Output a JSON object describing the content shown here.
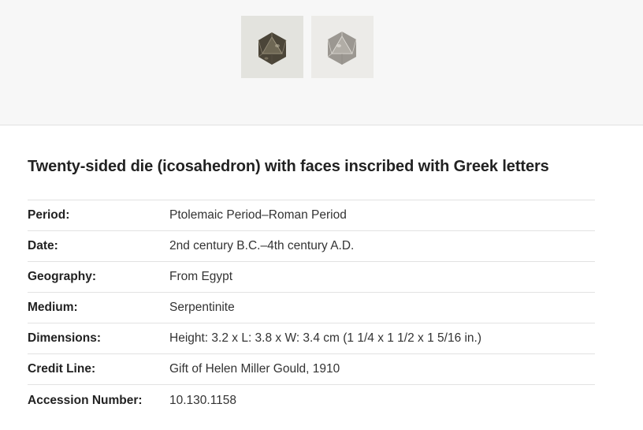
{
  "gallery": {
    "thumbnails": [
      {
        "icon": "dark-die-image",
        "colors": {
          "body": "#4b4538",
          "light": "#8c8472",
          "background": "#e3e3de"
        }
      },
      {
        "icon": "light-die-image",
        "colors": {
          "body": "#9b9791",
          "light": "#c9c6c0",
          "background": "#ecebe8"
        }
      }
    ]
  },
  "object": {
    "title": "Twenty-sided die (icosahedron) with faces inscribed with Greek letters",
    "facts": [
      {
        "label": "Period:",
        "value": "Ptolemaic Period–Roman Period"
      },
      {
        "label": "Date:",
        "value": "2nd century B.C.–4th century A.D."
      },
      {
        "label": "Geography:",
        "value": "From Egypt"
      },
      {
        "label": "Medium:",
        "value": "Serpentinite"
      },
      {
        "label": "Dimensions:",
        "value": "Height: 3.2 x L: 3.8 x W: 3.4 cm (1 1/4 x 1 1/2 x 1 5/16 in.)"
      },
      {
        "label": "Credit Line:",
        "value": "Gift of Helen Miller Gould, 1910"
      },
      {
        "label": "Accession Number:",
        "value": "10.130.1158"
      }
    ]
  },
  "colors": {
    "gallery_background": "#f7f7f7",
    "divider": "#e2e2e2",
    "title": "#222222",
    "text": "#333333"
  }
}
